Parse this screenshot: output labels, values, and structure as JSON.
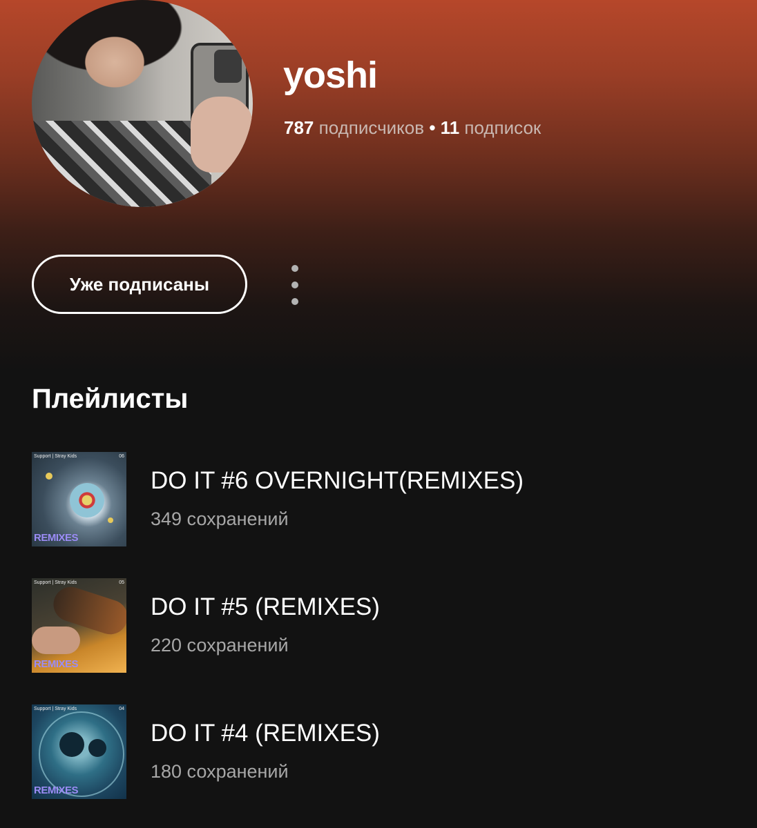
{
  "profile": {
    "username": "yoshi",
    "followers_count": "787",
    "followers_label": "подписчиков",
    "separator": "•",
    "following_count": "11",
    "following_label": "подписок",
    "follow_button_label": "Уже подписаны"
  },
  "colors": {
    "header_gradient_top": "#b6472a",
    "background": "#121212",
    "remix_label": "#9b8cf5"
  },
  "playlists_section": {
    "title": "Плейлисты",
    "items": [
      {
        "title": "DO IT #6 OVERNIGHT(REMIXES)",
        "saves": "349 сохранений",
        "cover_tag": "Support | Stray Kids",
        "cover_number": "06",
        "cover_label": "REMIXES"
      },
      {
        "title": "DO IT #5 (REMIXES)",
        "saves": "220 сохранений",
        "cover_tag": "Support | Stray Kids",
        "cover_number": "05",
        "cover_label": "REMIXES"
      },
      {
        "title": "DO IT #4 (REMIXES)",
        "saves": "180 сохранений",
        "cover_tag": "Support | Stray Kids",
        "cover_number": "04",
        "cover_label": "REMIXES"
      }
    ]
  },
  "icons": {
    "more": "more-vertical-icon"
  }
}
